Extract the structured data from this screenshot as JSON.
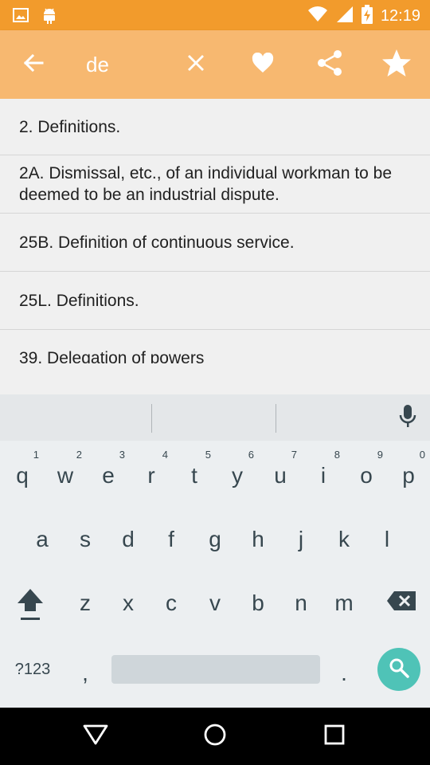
{
  "status_bar": {
    "time": "12:19",
    "icons": [
      "image-notification-icon",
      "android-icon",
      "wifi-icon",
      "cell-signal-icon",
      "battery-charging-icon"
    ]
  },
  "app_bar": {
    "search_value": "de",
    "icons": [
      "back-arrow-icon",
      "clear-icon",
      "heart-icon",
      "share-icon",
      "star-icon"
    ]
  },
  "results": [
    "2. Definitions.",
    "2A. Dismissal, etc., of an individual workman to be deemed to be an industrial dispute.",
    "25B. Definition of continuous service.",
    "25L. Definitions.",
    "39. Delegation of powers"
  ],
  "keyboard": {
    "row1": [
      "q",
      "w",
      "e",
      "r",
      "t",
      "y",
      "u",
      "i",
      "o",
      "p"
    ],
    "row1_hints": [
      "1",
      "2",
      "3",
      "4",
      "5",
      "6",
      "7",
      "8",
      "9",
      "0"
    ],
    "row2": [
      "a",
      "s",
      "d",
      "f",
      "g",
      "h",
      "j",
      "k",
      "l"
    ],
    "row3": [
      "z",
      "x",
      "c",
      "v",
      "b",
      "n",
      "m"
    ],
    "symbols_label": "?123",
    "comma": ",",
    "period": "."
  },
  "colors": {
    "status_bar": "#f29b2c",
    "app_bar": "#f7b870",
    "search_key": "#4fc3b7"
  }
}
